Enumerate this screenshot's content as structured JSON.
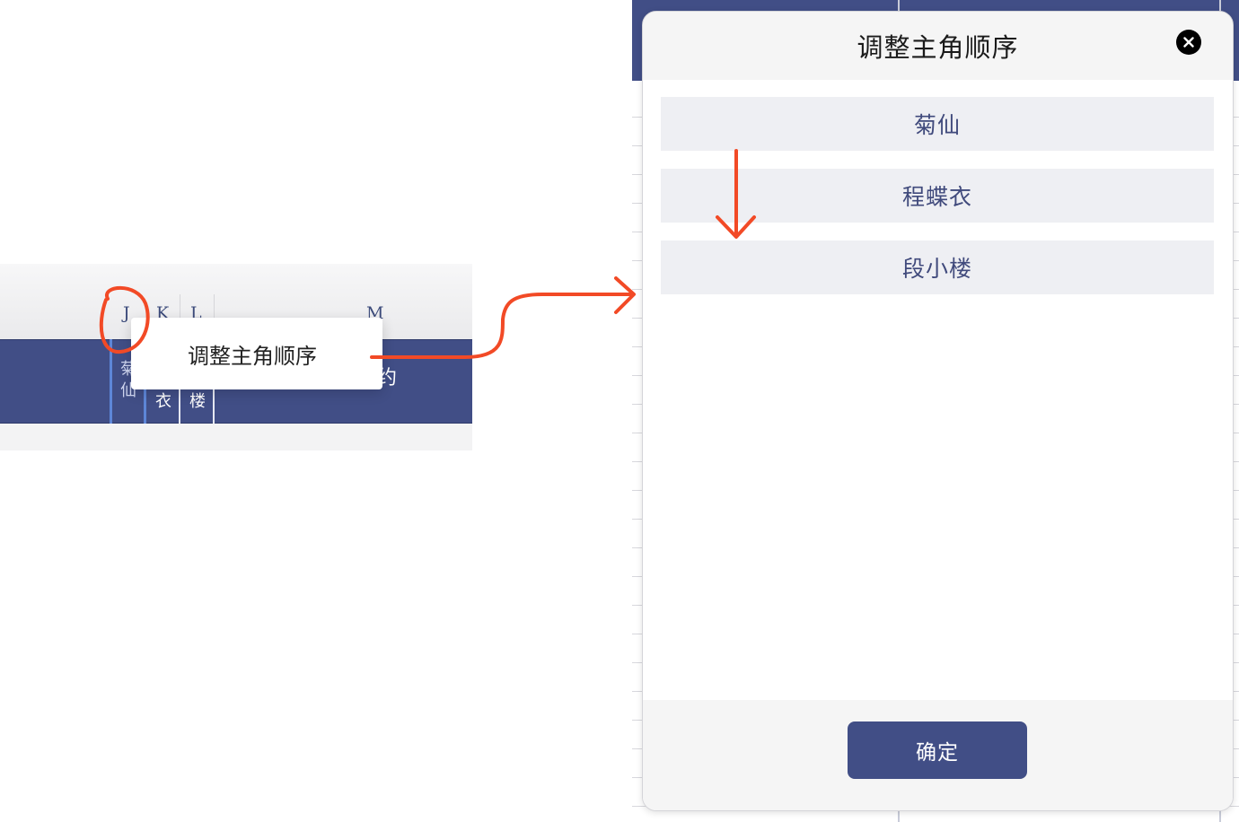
{
  "spreadsheet": {
    "column_letters": [
      "J",
      "K",
      "L",
      "M"
    ],
    "cells": [
      {
        "text": "菊\n仙"
      },
      {
        "text": "衣"
      },
      {
        "text": "楼"
      },
      {
        "text": "约"
      }
    ]
  },
  "context_menu": {
    "item_label": "调整主角顺序"
  },
  "dialog": {
    "title": "调整主角顺序",
    "items": [
      {
        "label": "菊仙"
      },
      {
        "label": "程蝶衣"
      },
      {
        "label": "段小楼"
      }
    ],
    "confirm_label": "确定"
  },
  "colors": {
    "accent_navy": "#414e86",
    "annotation_red": "#f24a26",
    "item_bg": "#eeeff3",
    "selection_blue": "#5d86d8"
  }
}
